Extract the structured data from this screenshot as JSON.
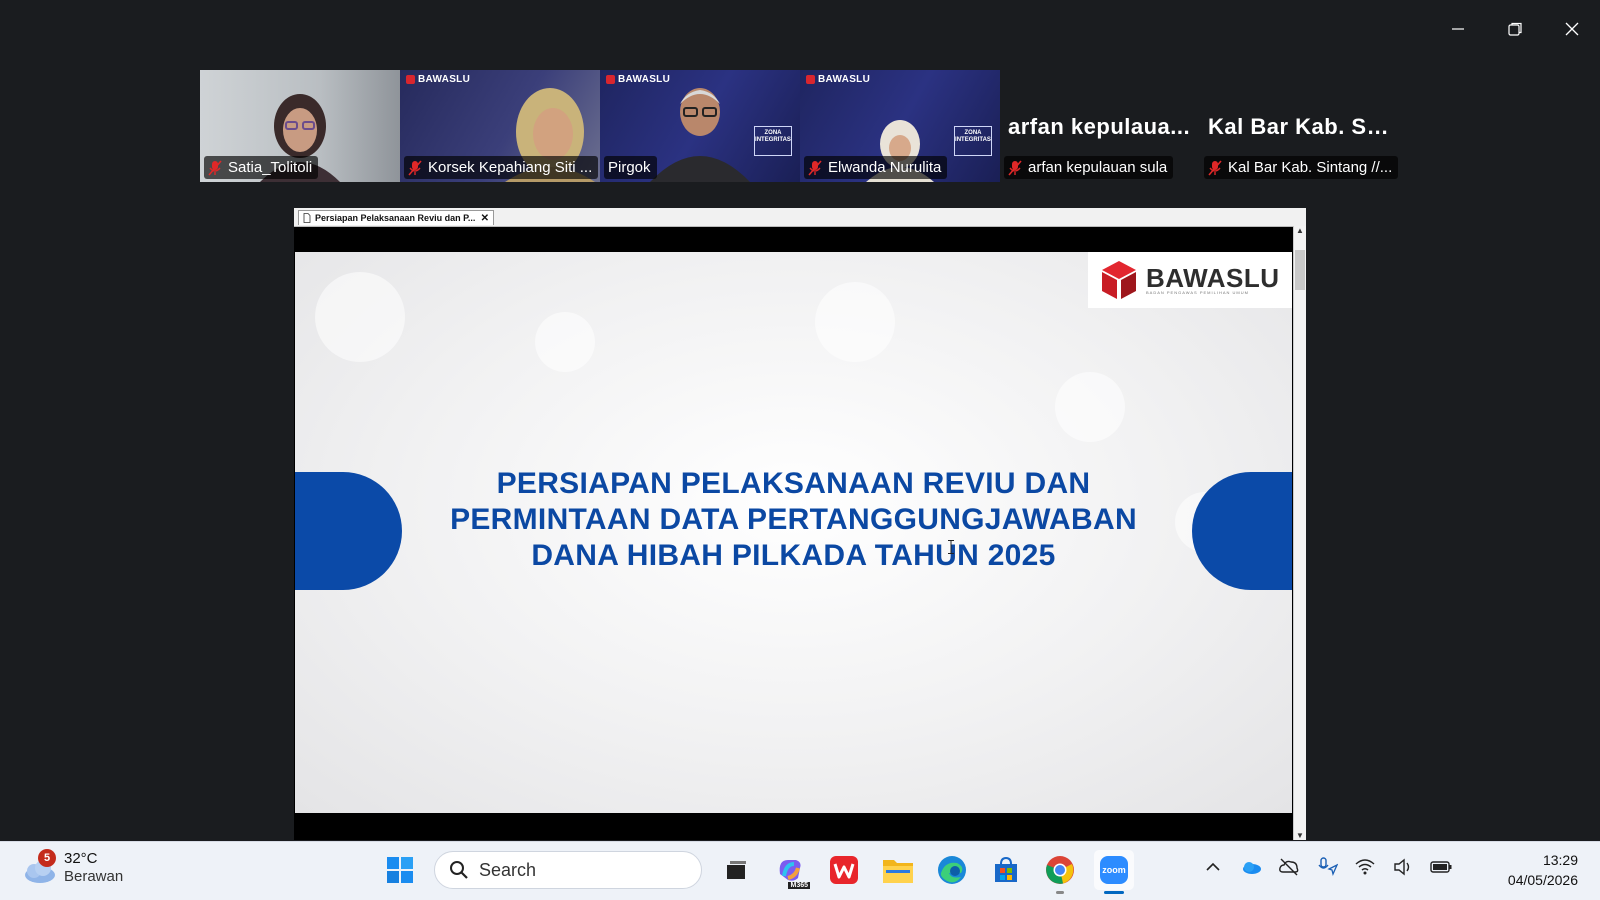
{
  "window": {
    "controls": [
      "minimize-icon",
      "restore-icon",
      "close-icon"
    ]
  },
  "participants": [
    {
      "name": "Satia_Tolitoli",
      "muted": true,
      "video": true,
      "brand": ""
    },
    {
      "name": "Korsek Kepahiang Siti ...",
      "muted": true,
      "video": true,
      "brand": "BAWASLU"
    },
    {
      "name": "Pirgok",
      "muted": false,
      "video": true,
      "active_speaker": true,
      "brand": "BAWASLU",
      "zona": "ZONA INTEGRITAS"
    },
    {
      "name": "Elwanda Nurulita",
      "muted": true,
      "video": true,
      "brand": "BAWASLU",
      "zona": "ZONA INTEGRITAS"
    },
    {
      "name": "arfan kepulauan sula",
      "display_title": "arfan kepulaua...",
      "muted": true,
      "video": false
    },
    {
      "name": "Kal Bar Kab. Sintang //...",
      "display_title": "Kal Bar Kab. Sin...",
      "muted": true,
      "video": false
    }
  ],
  "share": {
    "tab_title": "Persiapan Pelaksanaan Reviu dan P...",
    "slide": {
      "logo_text": "BAWASLU",
      "logo_subtext": "BADAN PENGAWAS PEMILIHAN UMUM",
      "title_lines": [
        "PERSIAPAN PELAKSANAAN REVIU DAN",
        "PERMINTAAN DATA PERTANGGUNGJAWABAN",
        "DANA HIBAH PILKADA TAHUN 2025"
      ],
      "accent_color": "#0b4aa8"
    }
  },
  "taskbar": {
    "weather": {
      "badge": "5",
      "temp": "32°C",
      "condition": "Berawan"
    },
    "search_placeholder": "Search",
    "apps": [
      "windows-start-icon",
      "task-view-icon",
      "m365-copilot-icon",
      "wps-office-icon",
      "file-explorer-icon",
      "edge-icon",
      "microsoft-store-icon",
      "chrome-icon",
      "zoom-icon"
    ],
    "m365_label": "M365",
    "zoom_label": "zoom",
    "tray": [
      "chevron-up-icon",
      "onedrive-icon",
      "cloud-off-icon",
      "microphone-location-icon",
      "wifi-icon",
      "volume-icon",
      "battery-icon"
    ],
    "clock": {
      "time": "13:29",
      "date": "04/05/2026"
    }
  }
}
